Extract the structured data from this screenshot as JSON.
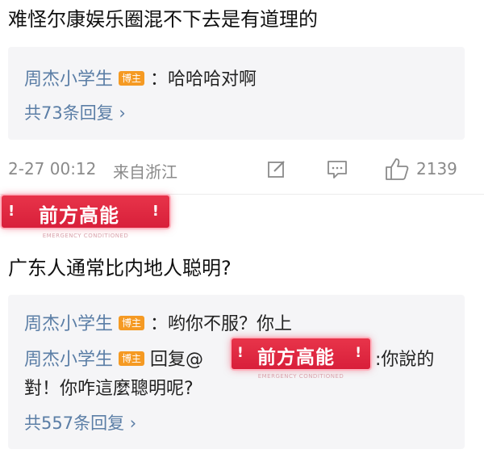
{
  "post1": {
    "comment": "难怪尔康娱乐圈混不下去是有道理的",
    "reply": {
      "author": "周杰小学生",
      "badge": "博主",
      "text": "：哈哈哈对啊"
    },
    "reply_count": "共73条回复 ›",
    "timestamp": "2-27 00:12",
    "location": "来自浙江",
    "like_count": "2139"
  },
  "banner": {
    "text": "前方高能",
    "subtext": "EMERGENCY CONDITIONED",
    "mark": "!"
  },
  "post2": {
    "comment": "广东人通常比内地人聪明?",
    "reply1": {
      "author": "周杰小学生",
      "badge": "博主",
      "text": "：哟你不服？你上"
    },
    "reply2": {
      "author": "周杰小学生",
      "badge": "博主",
      "prefix": "回复@",
      "suffix": ":你說的",
      "line2": "對！你咋這麼聰明呢?"
    },
    "reply_count": "共557条回复 ›"
  },
  "icons": {
    "edit": "edit-icon",
    "comment": "comment-icon",
    "like": "thumbs-up-icon"
  },
  "colors": {
    "author_blue": "#5b7ea6",
    "badge_orange": "#f59a23",
    "banner_red": "#e02a42",
    "reply_bg": "#f5f5f7"
  }
}
